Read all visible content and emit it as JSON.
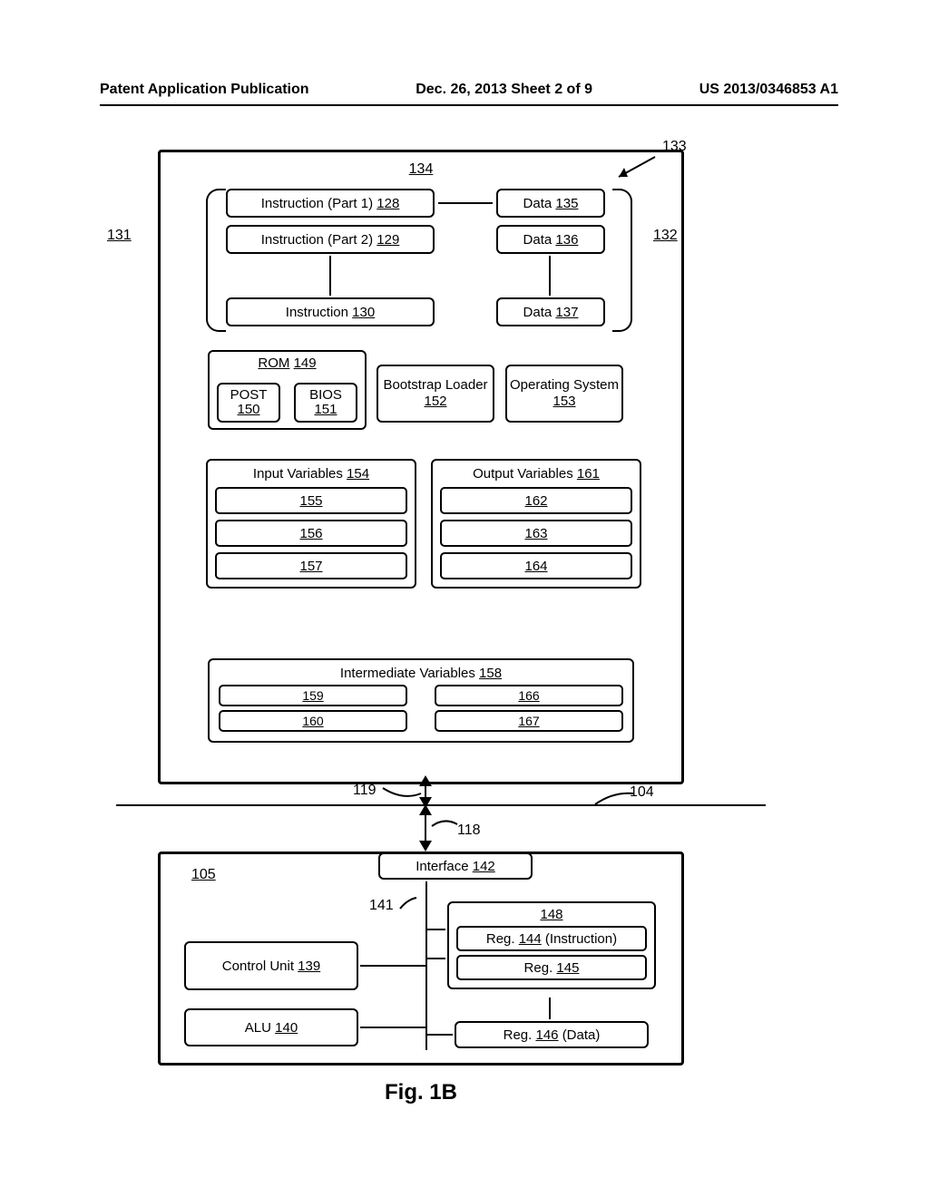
{
  "header": {
    "left": "Patent Application Publication",
    "center": "Dec. 26, 2013  Sheet 2 of 9",
    "right": "US 2013/0346853 A1"
  },
  "figure_caption": "Fig. 1B",
  "refs": {
    "r131": "131",
    "r132": "132",
    "r133": "133",
    "r134": "134",
    "r119": "119",
    "r104": "104",
    "r118": "118",
    "r105": "105",
    "r141": "141"
  },
  "top": {
    "instr1": {
      "label": "Instruction (Part 1)",
      "num": "128"
    },
    "instr2": {
      "label": "Instruction (Part 2)",
      "num": "129"
    },
    "instr3": {
      "label": "Instruction",
      "num": "130"
    },
    "data1": {
      "label": "Data",
      "num": "135"
    },
    "data2": {
      "label": "Data",
      "num": "136"
    },
    "data3": {
      "label": "Data",
      "num": "137"
    },
    "rom": {
      "title": "ROM",
      "num": "149",
      "post": {
        "label": "POST",
        "num": "150"
      },
      "bios": {
        "label": "BIOS",
        "num": "151"
      }
    },
    "bootstrap": {
      "label": "Bootstrap Loader",
      "num": "152"
    },
    "os": {
      "label": "Operating System",
      "num": "153"
    },
    "inputv": {
      "title": "Input Variables",
      "num": "154",
      "rows": [
        "155",
        "156",
        "157"
      ]
    },
    "outputv": {
      "title": "Output Variables",
      "num": "161",
      "rows": [
        "162",
        "163",
        "164"
      ]
    },
    "intermed": {
      "title": "Intermediate Variables",
      "num": "158",
      "left": [
        "159",
        "160"
      ],
      "right": [
        "166",
        "167"
      ]
    }
  },
  "bottom": {
    "iface": {
      "label": "Interface",
      "num": "142"
    },
    "cu": {
      "label": "Control Unit",
      "num": "139"
    },
    "alu": {
      "label": "ALU",
      "num": "140"
    },
    "reggrp": {
      "num": "148",
      "r144": {
        "label": "Reg.",
        "num": "144",
        "suffix": "(Instruction)"
      },
      "r145": {
        "label": "Reg.",
        "num": "145"
      },
      "r146": {
        "label": "Reg.",
        "num": "146",
        "suffix": "(Data)"
      }
    }
  }
}
